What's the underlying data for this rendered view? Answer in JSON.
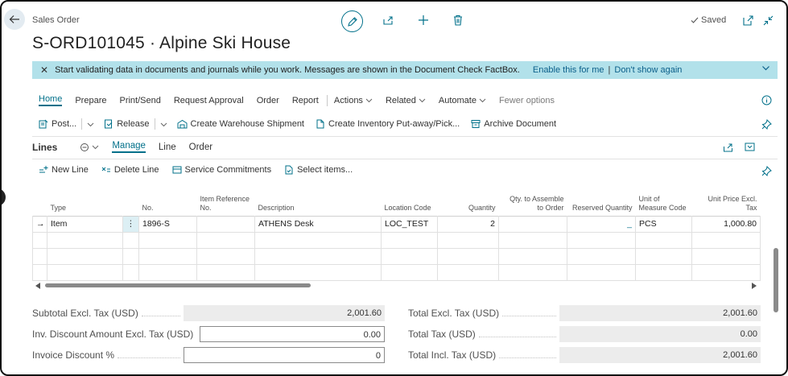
{
  "header": {
    "breadcrumb": "Sales Order",
    "title": "S-ORD101045 · Alpine Ski House",
    "saved_label": "Saved"
  },
  "banner": {
    "message": "Start validating data in documents and journals while you work. Messages are shown in the Document Check FactBox.",
    "enable_link": "Enable this for me",
    "separator": "|",
    "dismiss_link": "Don't show again"
  },
  "menu": {
    "items": [
      "Home",
      "Prepare",
      "Print/Send",
      "Request Approval",
      "Order",
      "Report"
    ],
    "dropdowns": [
      "Actions",
      "Related",
      "Automate"
    ],
    "fewer_options": "Fewer options"
  },
  "actions": {
    "post": "Post...",
    "release": "Release",
    "create_warehouse_shipment": "Create Warehouse Shipment",
    "create_inventory_putaway": "Create Inventory Put-away/Pick...",
    "archive_document": "Archive Document"
  },
  "lines": {
    "title": "Lines",
    "tabs": [
      "Manage",
      "Line",
      "Order"
    ],
    "actions": {
      "new_line": "New Line",
      "delete_line": "Delete Line",
      "service_commitments": "Service Commitments",
      "select_items": "Select items..."
    },
    "columns": [
      "Type",
      "No.",
      "Item Reference No.",
      "Description",
      "Location Code",
      "Quantity",
      "Qty. to Assemble to Order",
      "Reserved Quantity",
      "Unit of Measure Code",
      "Unit Price Excl. Tax"
    ],
    "rows": [
      {
        "type": "Item",
        "no": "1896-S",
        "item_ref": "",
        "description": "ATHENS Desk",
        "location": "LOC_TEST",
        "quantity": "2",
        "qty_assemble": "",
        "reserved": "_",
        "uom": "PCS",
        "unit_price": "1,000.80"
      }
    ]
  },
  "totals": {
    "subtotal_label": "Subtotal Excl. Tax (USD)",
    "subtotal_value": "2,001.60",
    "inv_discount_label": "Inv. Discount Amount Excl. Tax (USD)",
    "inv_discount_value": "0.00",
    "invoice_discount_pct_label": "Invoice Discount %",
    "invoice_discount_pct_value": "0",
    "total_excl_label": "Total Excl. Tax (USD)",
    "total_excl_value": "2,001.60",
    "total_tax_label": "Total Tax (USD)",
    "total_tax_value": "0.00",
    "total_incl_label": "Total Incl. Tax (USD)",
    "total_incl_value": "2,001.60"
  },
  "colors": {
    "accent": "#00708a",
    "banner_bg": "#b2e1ea",
    "readonly_field": "#ececec"
  }
}
